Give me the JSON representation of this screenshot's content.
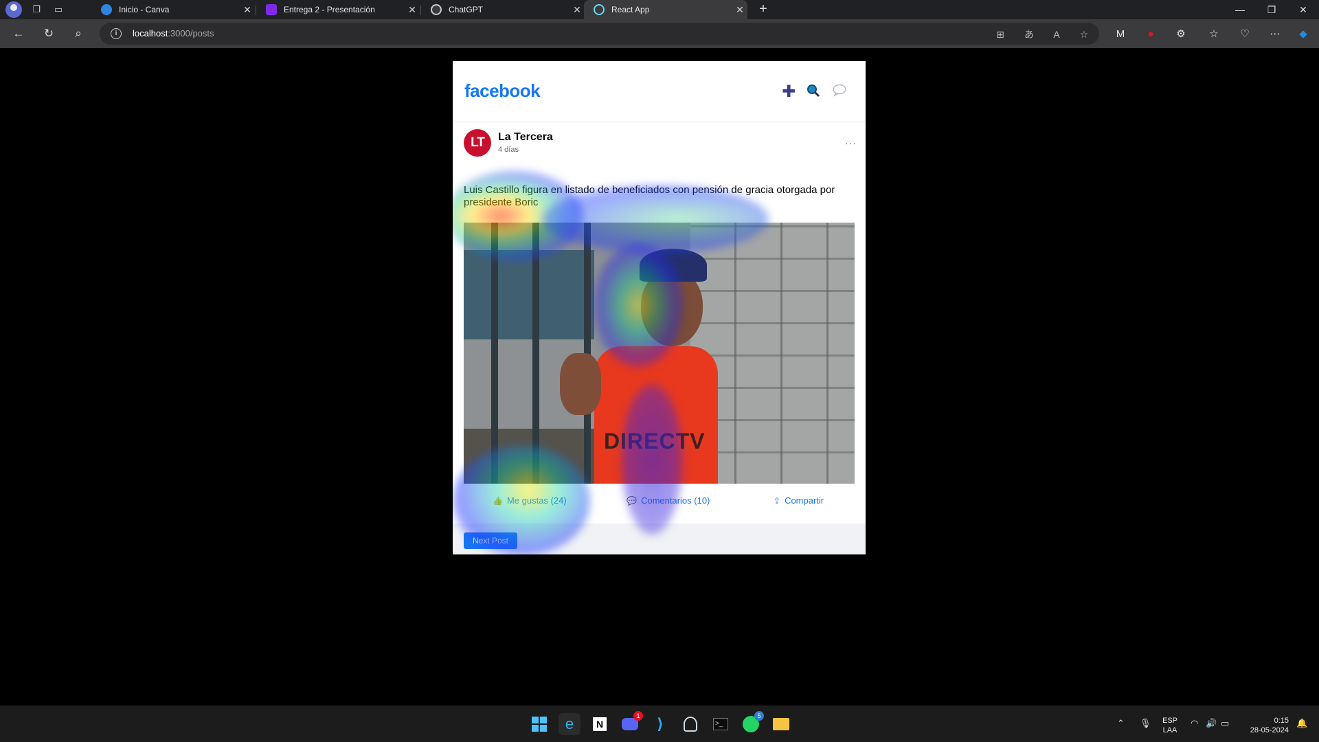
{
  "browser": {
    "tabs": [
      {
        "title": "Inicio - Canva",
        "favicon": "canva-icon",
        "color": "#2e86de"
      },
      {
        "title": "Entrega 2 - Presentación",
        "favicon": "canva-doc-icon",
        "color": "#7d2ae8"
      },
      {
        "title": "ChatGPT",
        "favicon": "chatgpt-icon",
        "color": "#cccccc"
      },
      {
        "title": "React App",
        "favicon": "react-icon",
        "color": "#61dafb"
      }
    ],
    "url_host": "localhost",
    "url_path": ":3000/posts"
  },
  "header": {
    "logo": "facebook",
    "accent": "#1877f2"
  },
  "post": {
    "avatar_initials": "LT",
    "author": "La Tercera",
    "time": "4 días",
    "more": "···",
    "text": "Luis Castillo figura en listado de beneficiados con pensión de gracia otorgada por presidente Boric",
    "photo_caption": "DIRECTV",
    "actions": {
      "like": "Me gustas (24)",
      "comments": "Comentarios (10)",
      "share": "Compartir"
    },
    "next_button": "Next Post"
  },
  "taskbar": {
    "lang_top": "ESP",
    "lang_bottom": "LAA",
    "time": "0:15",
    "date": "28-05-2024",
    "discord_badge": "1",
    "whatsapp_badge": "5"
  }
}
